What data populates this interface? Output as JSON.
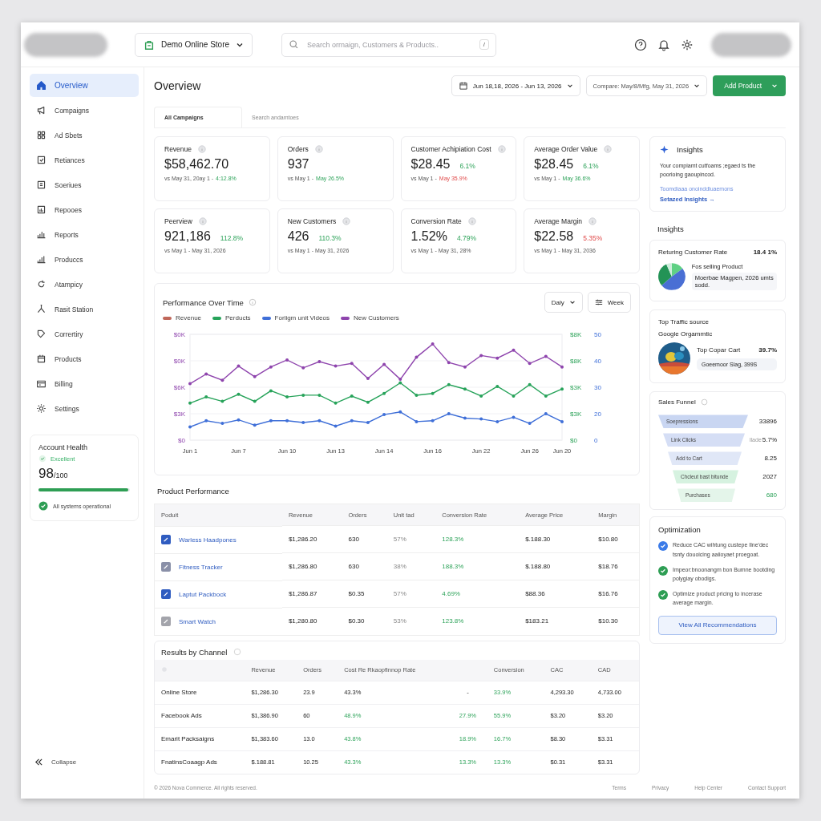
{
  "header": {
    "store": "Demo Online Store",
    "search_placeholder": "Search orrnaign, Customers & Products..",
    "search_key": "/"
  },
  "sidebar": {
    "items": [
      {
        "label": "Overview",
        "selected": true
      },
      {
        "label": "Compaigns",
        "selected": false
      },
      {
        "label": "Ad Sbets",
        "selected": false
      },
      {
        "label": "Retiances",
        "selected": false
      },
      {
        "label": "Soeriues",
        "selected": false
      },
      {
        "label": "Repooes",
        "selected": false
      },
      {
        "label": "Reports",
        "selected": false
      },
      {
        "label": "Produccs",
        "selected": false
      },
      {
        "label": "Atampicy",
        "selected": false
      },
      {
        "label": "Rasit Station",
        "selected": false
      },
      {
        "label": "Corrertiry",
        "selected": false
      },
      {
        "label": "Products",
        "selected": false
      },
      {
        "label": "Billing",
        "selected": false
      },
      {
        "label": "Settings",
        "selected": false
      }
    ],
    "health": {
      "title": "Account Health",
      "status": "Excellent",
      "score": "98",
      "max": "/100",
      "level": 0.98,
      "note": "All systems operational"
    },
    "collapse": "Collapse"
  },
  "page": {
    "title": "Overview",
    "date_range": "Jun 18,18, 2026 - Jun 13, 2026",
    "compare": "Compare: May/8/Mfg, May 31, 2026",
    "primary_button": "Add Product"
  },
  "tabs": [
    {
      "label": "All Campaigns",
      "selected": true
    },
    {
      "label": "Search andamtoes",
      "selected": false
    }
  ],
  "kpis": [
    {
      "title": "Revenue",
      "value": "$58,462.70",
      "compare": "vs May 31, 20ay 1 -",
      "delta": "4:12.8%",
      "delta_positive": true
    },
    {
      "title": "Orders",
      "value": "937",
      "compare": "vs May 1 -",
      "delta": "May 26.5%",
      "delta_positive": true
    },
    {
      "title": "Customer Achipiation Cost",
      "value": "$28.45",
      "change": "6.1%",
      "change_positive": true,
      "compare": "vs May 1 -",
      "delta": "May 35.9%",
      "delta_positive": false
    },
    {
      "title": "Average Order Value",
      "value": "$28.45",
      "change": "6.1%",
      "change_positive": true,
      "compare": "vs May 1 -",
      "delta": "May 36.6%",
      "delta_positive": true
    },
    {
      "title": "Peerview",
      "value": "921,186",
      "change": "112.8%",
      "change_positive": true,
      "compare": "vs May 1 - May 31, 2026"
    },
    {
      "title": "New Customers",
      "value": "426",
      "change": "110.3%",
      "change_positive": true,
      "compare": "vs May 1 - May 31, 2026"
    },
    {
      "title": "Conversion Rate",
      "value": "1.52%",
      "change": "4.79%",
      "change_positive": true,
      "compare": "vs May 1 - May 31, 28%"
    },
    {
      "title": "Average Margin",
      "value": "$22.58",
      "change": "5.35%",
      "change_positive": false,
      "compare": "vs May 1 - May 31, 2036"
    }
  ],
  "performance": {
    "title": "Performance Over Time",
    "interval": "Daly",
    "range": "Week",
    "unreadable_ticks": [
      "$0K",
      "$0K"
    ],
    "right_axis_money": [
      "$8K",
      "$8K",
      "$3K",
      "$3K",
      "$0"
    ],
    "right_axis_count": [
      "50",
      "40",
      "30",
      "20",
      "0"
    ],
    "chart_data": {
      "type": "line",
      "categories": [
        "Jun 1",
        null,
        null,
        "Jun 7",
        null,
        null,
        "Jun 10",
        null,
        null,
        "Jun 13",
        null,
        null,
        "Jun 14",
        null,
        null,
        "Jun 16",
        null,
        null,
        "Jun 22",
        null,
        null,
        "Jun 26",
        null,
        "Jun 20"
      ],
      "ylim": [
        0,
        12000
      ],
      "grid": true,
      "yticks": [
        {
          "value": 0,
          "label": "$0"
        },
        {
          "value": 3000,
          "label": "$3K"
        },
        {
          "value": 6000,
          "label": "$6K"
        }
      ],
      "series": [
        {
          "name": "Revenue",
          "color": "#c0675a",
          "values": [
            null,
            null,
            null,
            null,
            null,
            null,
            null,
            null,
            null,
            null,
            null,
            null,
            null,
            null,
            null,
            null,
            null,
            null,
            null,
            null,
            null,
            null,
            null,
            null
          ]
        },
        {
          "name": "Perducts",
          "color": "#27a35a",
          "values": [
            4200,
            4900,
            4400,
            5200,
            4400,
            5600,
            4900,
            5100,
            5100,
            4200,
            5000,
            4300,
            5300,
            6500,
            5100,
            5300,
            6300,
            5800,
            5000,
            6100,
            5000,
            6300,
            5000,
            5800
          ]
        },
        {
          "name": "Forligm unit Videos",
          "color": "#3f6fd8",
          "values": [
            1500,
            2200,
            1900,
            2300,
            1700,
            2200,
            2200,
            2000,
            2200,
            1600,
            2200,
            2000,
            2900,
            3200,
            2100,
            2200,
            3000,
            2500,
            2400,
            2100,
            2600,
            1900,
            3000,
            2100
          ]
        },
        {
          "name": "New Customers",
          "color": "#8e44ad",
          "values": [
            6400,
            7500,
            6800,
            8400,
            7200,
            8300,
            9100,
            8200,
            8900,
            8400,
            8700,
            7000,
            8600,
            6900,
            9400,
            10900,
            8800,
            8300,
            9600,
            9300,
            10200,
            8700,
            9500,
            8300
          ]
        }
      ]
    }
  },
  "products": {
    "title": "Product Performance",
    "columns": [
      "Poduit",
      "Revenue",
      "Orders",
      "Unit tad",
      "Conversion Rate",
      "Average Price",
      "Margin"
    ],
    "rows": [
      {
        "checked": true,
        "color": "#2f5cc0",
        "cells": [
          "Warless Haadpones",
          "$1,286.20",
          "630",
          "57%",
          "128.3%",
          "$.188.30",
          "$10.80"
        ]
      },
      {
        "checked": true,
        "color": "#8a90a8",
        "cells": [
          "Fitness Tracker",
          "$1,286.80",
          "630",
          "38%",
          "188.3%",
          "$.188.80",
          "$18.76"
        ]
      },
      {
        "checked": true,
        "color": "#2f5cc0",
        "cells": [
          "Laptut Packbock",
          "$1,286.87",
          "$0.35",
          "57%",
          "4.69%",
          "$88.36",
          "$16.76"
        ]
      },
      {
        "checked": true,
        "color": "#a3a4ab",
        "cells": [
          "Smart Watch",
          "$1,280.80",
          "$0.30",
          "53%",
          "123.8%",
          "$183.21",
          "$10.30"
        ]
      }
    ]
  },
  "channels": {
    "title": "Results by Channel",
    "columns": [
      {},
      {
        "label": "Revenue"
      },
      {
        "label": "Orders"
      },
      {
        "label": "Cost Re Rkaopfinnop Rate"
      },
      {},
      {
        "label": "Conversion"
      },
      {
        "label": "CAC"
      },
      {
        "label": "CAD"
      }
    ],
    "rows": [
      {
        "cells": [
          "Online Store",
          "$1,286.30",
          "23.9",
          "43.3%",
          "-",
          "33.9%",
          "4,293.30",
          "4,733.00"
        ],
        "positive": [
          false,
          false,
          false,
          false,
          false,
          true,
          false,
          false
        ]
      },
      {
        "cells": [
          "Facebook Ads",
          "$1,386.90",
          "60",
          "48.9%",
          "27.9%",
          "55.9%",
          "$3.20",
          "$3.20"
        ],
        "positive": [
          false,
          false,
          false,
          true,
          true,
          true,
          false,
          false
        ]
      },
      {
        "cells": [
          "Emarit Packsaigns",
          "$1,383.60",
          "13.0",
          "43.8%",
          "18.9%",
          "16.7%",
          "$8.30",
          "$3.31"
        ],
        "positive": [
          false,
          false,
          false,
          true,
          true,
          true,
          false,
          false
        ]
      },
      {
        "cells": [
          "FnatinsCoaagp Ads",
          "$.188.81",
          "10.25",
          "43.3%",
          "13.3%",
          "13.3%",
          "$0.31",
          "$3.31"
        ],
        "positive": [
          false,
          false,
          false,
          true,
          true,
          true,
          false,
          false
        ]
      }
    ]
  },
  "insights": {
    "title": "Insights",
    "text": "Your compiamt cutfoams ;egaed ts the poorioing gaoupincod.",
    "link": "Toomdiaaa onoinddluaemons",
    "action": "Setazed Insights →"
  },
  "insights_section": {
    "title": "Insights",
    "returning": {
      "label": "Returing Customer Rate",
      "value": "18.4 1%",
      "product_title": "Fos selling Product",
      "product_text": "Moerbae Magpen, 2026 umts sodd."
    },
    "traffic": {
      "title": "Top Traffic source",
      "source": "Google Orgammtic",
      "item": "Top Copar Cart",
      "value": "39.7%",
      "detail": "Goeemoor Slag, 399S"
    }
  },
  "funnel": {
    "title": "Sales Funnel",
    "steps": [
      {
        "label": "Soepressions",
        "value": "33896",
        "color": "#c9d6f2",
        "positive": false
      },
      {
        "label": "Link Clicks",
        "note": "llade",
        "value": "5.7%",
        "color": "#d5def5",
        "positive": false
      },
      {
        "label": "Add to Cart",
        "value": "8.25",
        "color": "#e0e7f7",
        "positive": false
      },
      {
        "label": "Chcleut bast bitunde",
        "value": "2027",
        "color": "#d6f2e0",
        "positive": false
      },
      {
        "label": "Purchases",
        "value": "680",
        "color": "#e4f5ea",
        "positive": true
      }
    ]
  },
  "optimization": {
    "title": "Optimization",
    "items": [
      {
        "text": "Reduce CAC wihtung custepe Ilne'dec tsnty douoicing aaiioyaet proegoat.",
        "color": "#3b7be8"
      },
      {
        "text": "Impeor:bnoonangm bon Bumne bootding polygiay obodigs.",
        "color": "#2e9e54"
      },
      {
        "text": "Optimize product pricing to incerase average margin.",
        "color": "#2e9e54"
      }
    ],
    "button": "View All Recommendations"
  },
  "footer": {
    "copyright": "© 2026 Nova Commerce. All rights reserved.",
    "links": [
      "Terms",
      "Privacy",
      "Help Center",
      "Contact Support"
    ]
  }
}
